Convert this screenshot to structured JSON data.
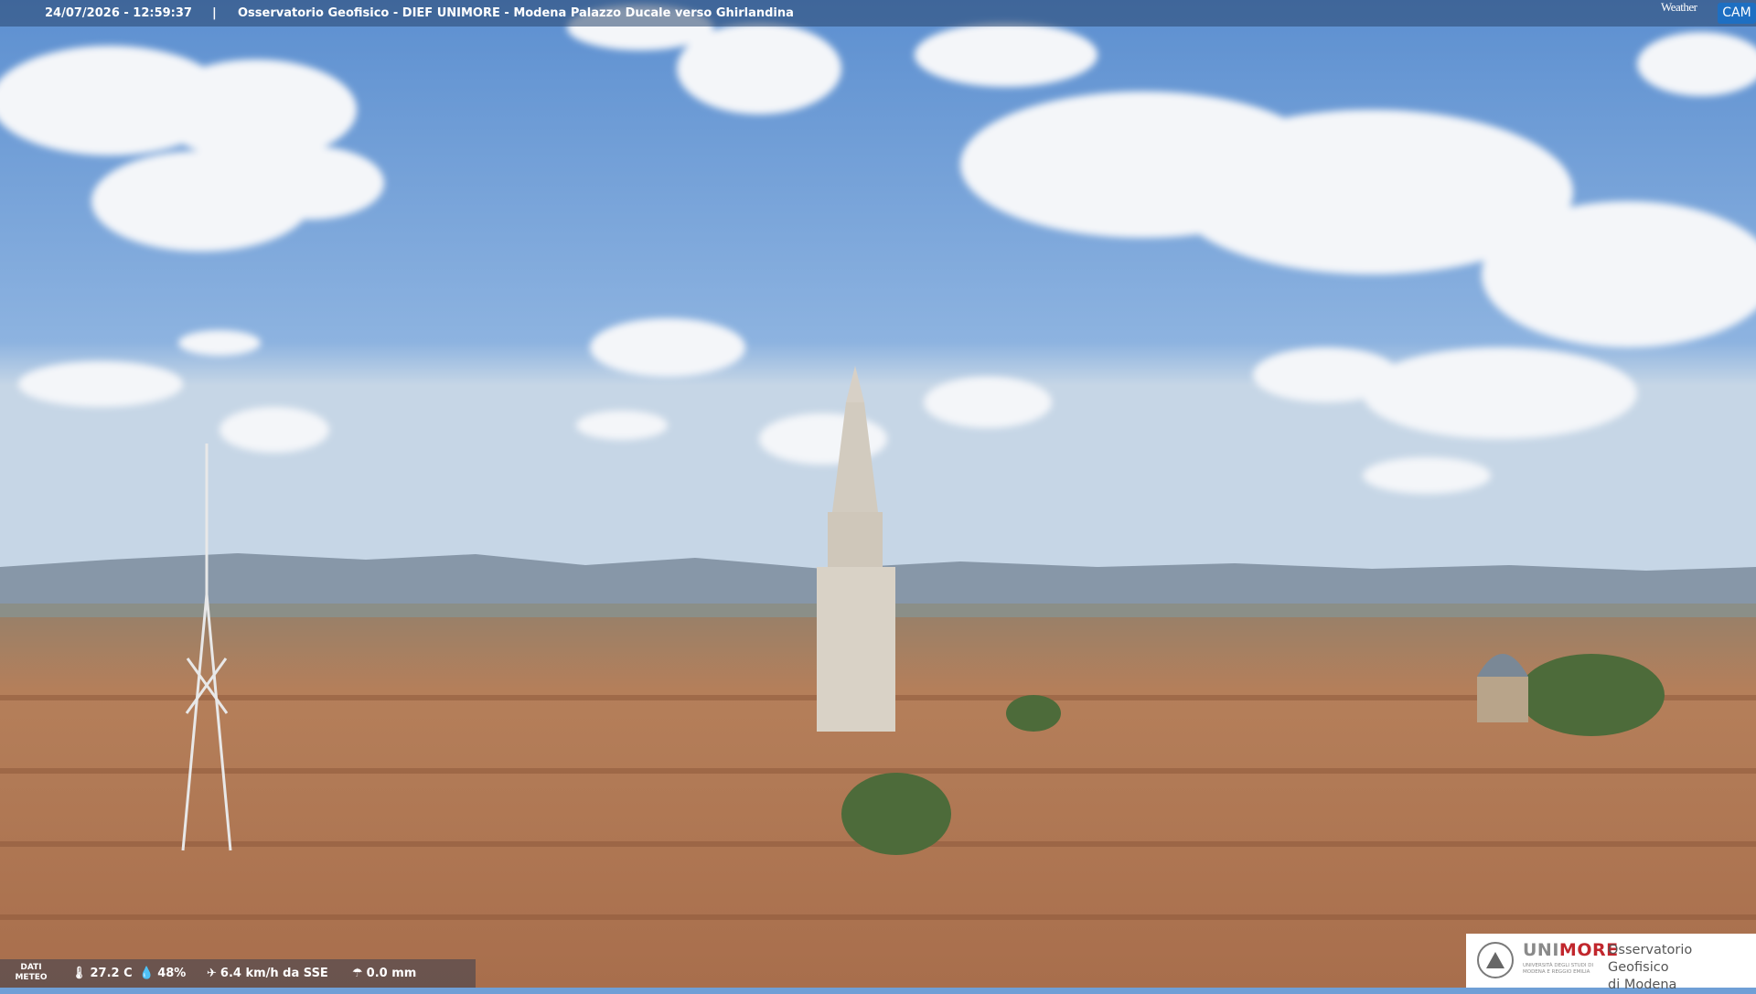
{
  "overlay": {
    "timestamp": "24/07/2026 - 12:59:37",
    "separator": "|",
    "caption": "Osservatorio Geofisico - DIEF UNIMORE - Modena Palazzo Ducale verso Ghirlandina"
  },
  "logo": {
    "weather": "Weather",
    "cam": "CAM"
  },
  "weather_bar": {
    "label_line1": "DATI",
    "label_line2": "METEO",
    "temperature": "27.2 C",
    "humidity": "48%",
    "wind": "6.4 km/h da SSE",
    "rain": "0.0 mm"
  },
  "institution": {
    "brand_prefix": "UNI",
    "brand_suffix": "MORE",
    "subtitle": "UNIVERSITÀ DEGLI STUDI DI MODENA E REGGIO EMILIA",
    "observatory_line1": "Osservatorio Geofisico",
    "observatory_line2": "di Modena"
  },
  "colors": {
    "sky": "#6f9fd6",
    "roofs": "#b9825c",
    "bar": "#28466e",
    "cam_logo": "#1e6fc2",
    "unimore_red": "#c1272d"
  }
}
